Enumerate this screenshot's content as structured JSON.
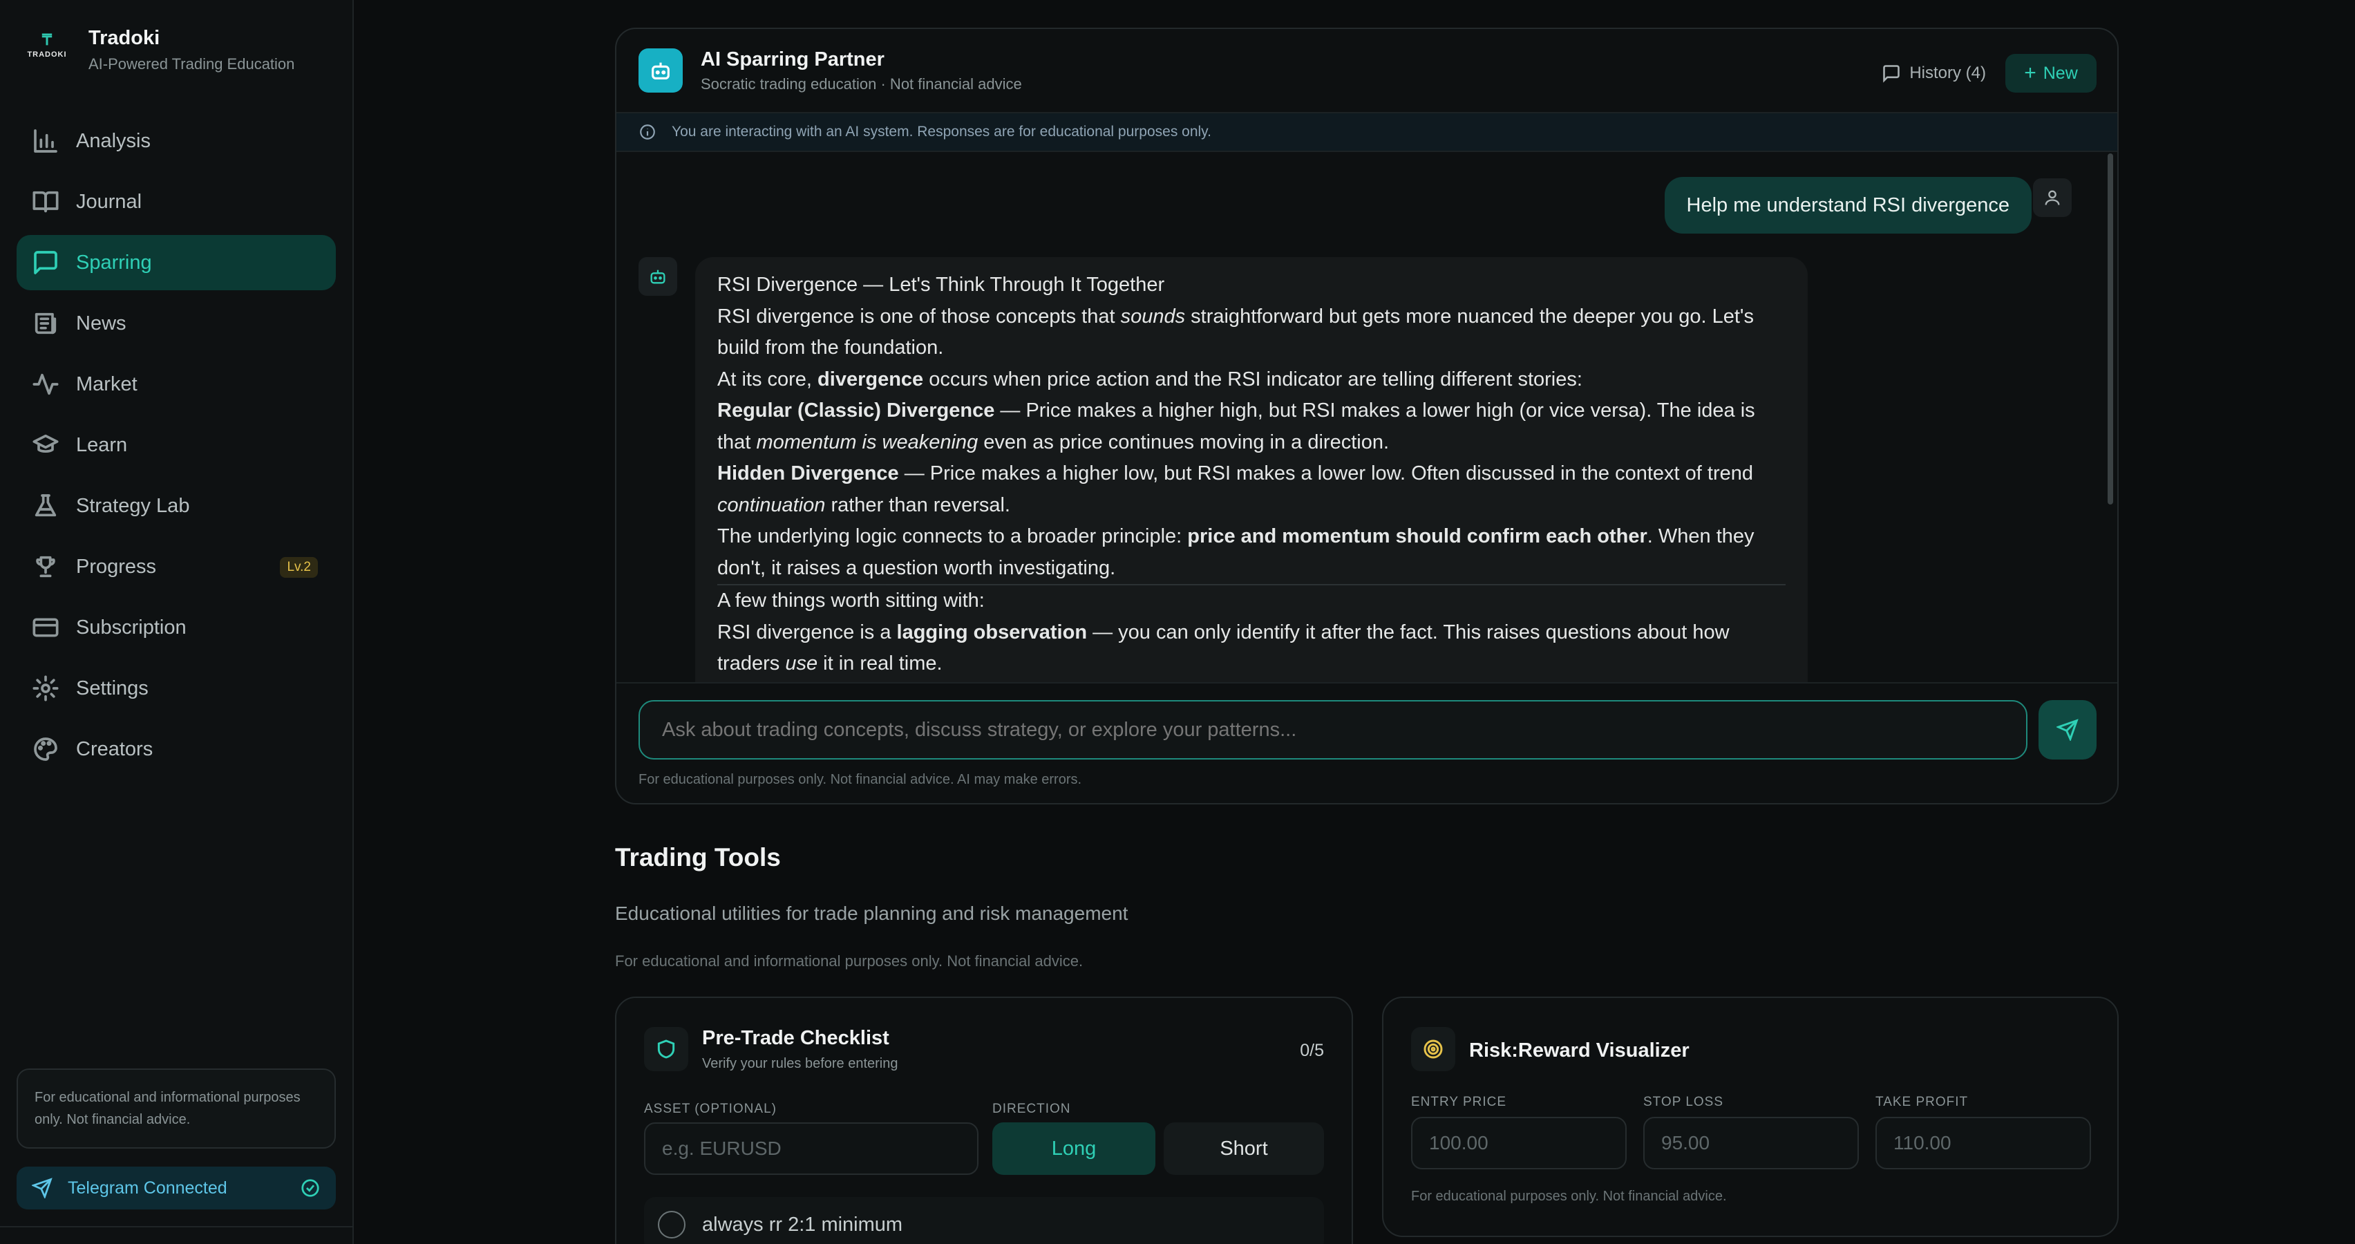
{
  "brand": {
    "name": "Tradoki",
    "subtitle": "AI-Powered Trading Education",
    "logo_word": "TRADOKI"
  },
  "nav": {
    "items": [
      {
        "label": "Analysis",
        "icon": "bar-chart-icon"
      },
      {
        "label": "Journal",
        "icon": "book-icon"
      },
      {
        "label": "Sparring",
        "icon": "chat-icon",
        "active": true
      },
      {
        "label": "News",
        "icon": "newspaper-icon"
      },
      {
        "label": "Market",
        "icon": "activity-icon"
      },
      {
        "label": "Learn",
        "icon": "graduation-cap-icon"
      },
      {
        "label": "Strategy Lab",
        "icon": "flask-icon"
      },
      {
        "label": "Progress",
        "icon": "trophy-icon",
        "badge": "Lv.2"
      },
      {
        "label": "Subscription",
        "icon": "credit-card-icon"
      },
      {
        "label": "Settings",
        "icon": "gear-icon"
      },
      {
        "label": "Creators",
        "icon": "palette-icon"
      }
    ]
  },
  "sidebar_disclaimer": "For educational and informational purposes only. Not financial advice.",
  "telegram": {
    "label": "Telegram Connected"
  },
  "chat": {
    "title": "AI Sparring Partner",
    "subtitle": "Socratic trading education · Not financial advice",
    "history_label": "History (4)",
    "new_label": "New",
    "notice": "You are interacting with an AI system. Responses are for educational purposes only.",
    "user_message": "Help me understand RSI divergence",
    "assistant": {
      "heading": "RSI Divergence — Let's Think Through It Together",
      "p1_a": "RSI divergence is one of those concepts that ",
      "p1_em": "sounds",
      "p1_b": " straightforward but gets more nuanced the deeper you go. Let's build from the foundation.",
      "p2_a": "At its core, ",
      "p2_strong": "divergence",
      "p2_b": " occurs when price action and the RSI indicator are telling different stories:",
      "p3_strong": "Regular (Classic) Divergence",
      "p3_a": " — Price makes a higher high, but RSI makes a lower high (or vice versa). The idea is that ",
      "p3_em": "momentum is weakening",
      "p3_b": " even as price continues moving in a direction.",
      "p4_strong": "Hidden Divergence",
      "p4_a": " — Price makes a higher low, but RSI makes a lower low. Often discussed in the context of trend ",
      "p4_em": "continuation",
      "p4_b": " rather than reversal.",
      "p5_a": "The underlying logic connects to a broader principle: ",
      "p5_strong": "price and momentum should confirm each other",
      "p5_b": ". When they don't, it raises a question worth investigating.",
      "p6": "A few things worth sitting with:",
      "p7_a": "RSI divergence is a ",
      "p7_strong": "lagging observation",
      "p7_b": " — you can only identify it after the fact. This raises questions about how traders ",
      "p7_em": "use",
      "p7_c": " it in real time."
    },
    "input_placeholder": "Ask about trading concepts, discuss strategy, or explore your patterns...",
    "footer_note": "For educational purposes only. Not financial advice. AI may make errors."
  },
  "tools": {
    "title": "Trading Tools",
    "subtitle": "Educational utilities for trade planning and risk management",
    "note": "For educational and informational purposes only. Not financial advice.",
    "checklist": {
      "title": "Pre-Trade Checklist",
      "subtitle": "Verify your rules before entering",
      "count": "0/5",
      "asset_label": "ASSET (OPTIONAL)",
      "asset_placeholder": "e.g. EURUSD",
      "direction_label": "DIRECTION",
      "long_label": "Long",
      "short_label": "Short",
      "rule_1": "always rr 2:1 minimum"
    },
    "rr": {
      "title": "Risk:Reward Visualizer",
      "entry_label": "ENTRY PRICE",
      "entry_placeholder": "100.00",
      "stop_label": "STOP LOSS",
      "stop_placeholder": "95.00",
      "take_label": "TAKE PROFIT",
      "take_placeholder": "110.00",
      "note": "For educational purposes only. Not financial advice."
    }
  },
  "colors": {
    "accent": "#2fd0b6",
    "active_bg": "#0b3a34",
    "badge": "#e6c24a",
    "telegram": "#5ec6e8",
    "bot_badge": "#17b0c4"
  }
}
